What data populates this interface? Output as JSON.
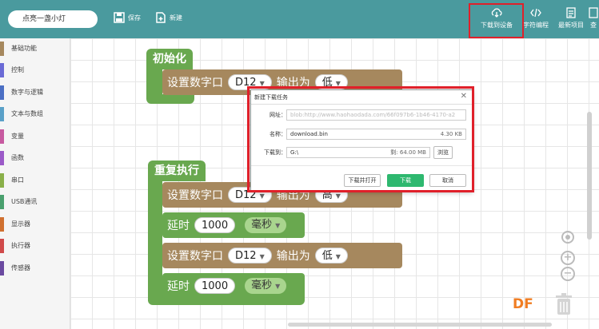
{
  "topbar": {
    "project_name": "点亮一盏小灯",
    "save_label": "保存",
    "new_label": "新建",
    "download_label": "下载到设备",
    "code_label": "字符编程",
    "latest_label": "最新项目",
    "more_label": "查"
  },
  "sidebar": {
    "items": [
      {
        "label": "基础功能",
        "color": "#a6885e"
      },
      {
        "label": "控制",
        "color": "#6b6bd6"
      },
      {
        "label": "数字与逻辑",
        "color": "#4b6fc4"
      },
      {
        "label": "文本与数组",
        "color": "#5aa0c8"
      },
      {
        "label": "变量",
        "color": "#c75aa0"
      },
      {
        "label": "函数",
        "color": "#9b5ac8"
      },
      {
        "label": "串口",
        "color": "#8ab04a"
      },
      {
        "label": "USB通讯",
        "color": "#4aa06e"
      },
      {
        "label": "显示器",
        "color": "#d07030"
      },
      {
        "label": "执行器",
        "color": "#d04a4a"
      },
      {
        "label": "传感器",
        "color": "#6b4aa0"
      }
    ]
  },
  "blocks": {
    "init_label": "初始化",
    "loop_label": "重复执行",
    "set_pin": "设置数字口",
    "output_as": "输出为",
    "pin": "D12",
    "low": "低",
    "high": "高",
    "delay": "延时",
    "delay_value": "1000",
    "ms": "毫秒"
  },
  "dialog": {
    "title": "新建下载任务",
    "url_label": "网址：",
    "url_value": "blob:http://www.haohaodada.com/66f097b6-1b46-4170-a2",
    "name_label": "名称：",
    "name_value": "download.bin",
    "size": "4.30 KB",
    "dest_label": "下载到：",
    "dest_value": "G:\\",
    "free_space": "剩: 64.00 MB",
    "browse_label": "浏览",
    "open_label": "下载并打开",
    "download_label": "下载",
    "cancel_label": "取消"
  },
  "brand": {
    "logo_text": "DF"
  },
  "colors": {
    "topbar": "#4a9a9e",
    "block_green": "#69a84f",
    "block_brown": "#a6885e",
    "highlight": "#e0202a"
  }
}
